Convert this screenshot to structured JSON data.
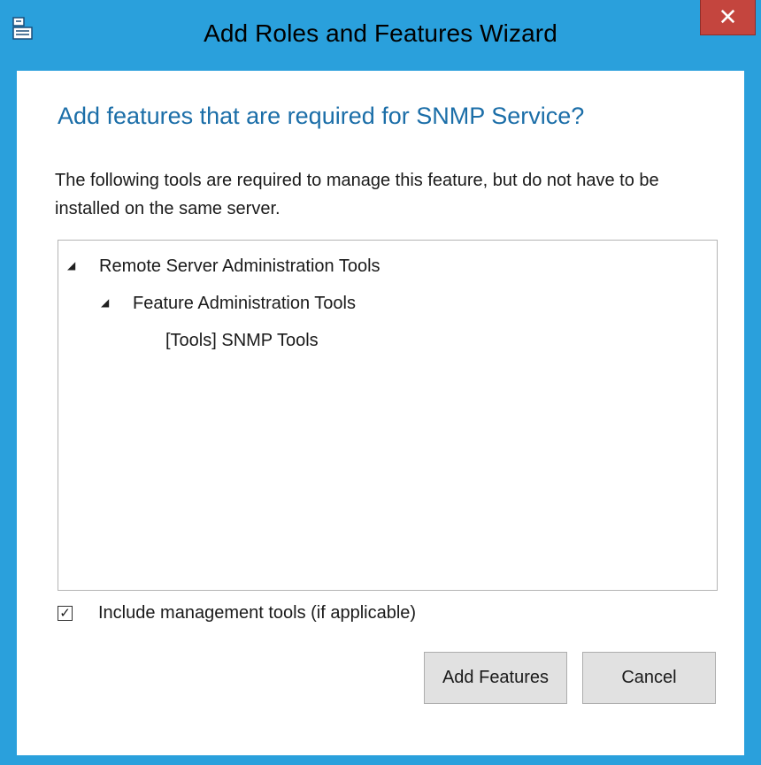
{
  "window": {
    "title": "Add Roles and Features Wizard",
    "close_symbol": "✕",
    "app_icon": "server-manager-icon"
  },
  "dialog": {
    "heading": "Add features that are required for SNMP Service?",
    "description": "The following tools are required to manage this feature, but do not have to be installed on the same server."
  },
  "tree": {
    "items": [
      {
        "label": "Remote Server Administration Tools",
        "expanded": true,
        "toggle": "◢"
      },
      {
        "label": "Feature Administration Tools",
        "expanded": true,
        "toggle": "◢"
      },
      {
        "label": "[Tools] SNMP Tools"
      }
    ]
  },
  "options": {
    "include_tools_label": "Include management tools (if applicable)",
    "include_tools_checked": true,
    "check_mark": "✓"
  },
  "buttons": {
    "add_label": "Add Features",
    "cancel_label": "Cancel"
  },
  "colors": {
    "titlebar": "#2aa0dc",
    "heading": "#1b6ea8",
    "close": "#c4453e"
  }
}
